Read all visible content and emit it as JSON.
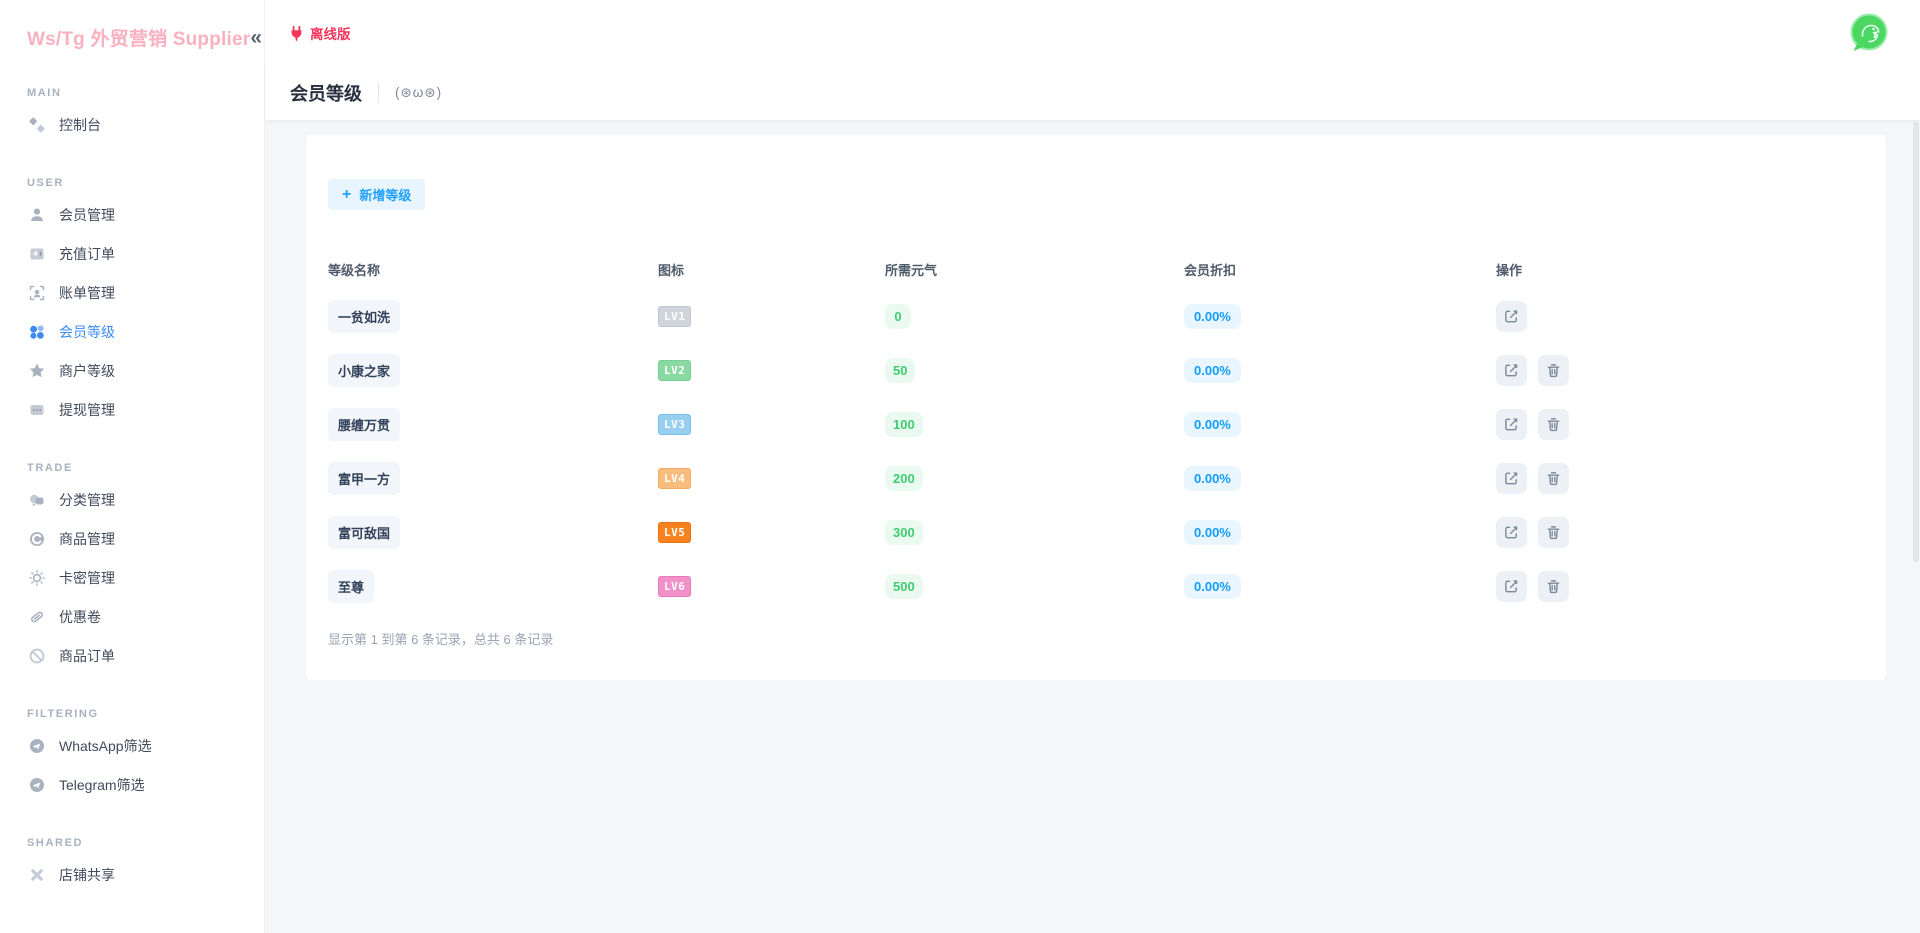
{
  "sidebar": {
    "logo": "Ws/Tg 外贸营销 Supplier",
    "collapse_glyph": "«",
    "sections": [
      {
        "label": "MAIN",
        "items": [
          {
            "label": "控制台",
            "icon": "console-icon",
            "active": false
          }
        ]
      },
      {
        "label": "USER",
        "items": [
          {
            "label": "会员管理",
            "icon": "member-management-icon",
            "active": false
          },
          {
            "label": "充值订单",
            "icon": "recharge-orders-icon",
            "active": false
          },
          {
            "label": "账单管理",
            "icon": "billing-icon",
            "active": false
          },
          {
            "label": "会员等级",
            "icon": "member-level-icon",
            "active": true
          },
          {
            "label": "商户等级",
            "icon": "merchant-level-icon",
            "active": false
          },
          {
            "label": "提现管理",
            "icon": "withdrawal-icon",
            "active": false
          }
        ]
      },
      {
        "label": "TRADE",
        "items": [
          {
            "label": "分类管理",
            "icon": "category-icon",
            "active": false
          },
          {
            "label": "商品管理",
            "icon": "product-icon",
            "active": false
          },
          {
            "label": "卡密管理",
            "icon": "card-key-icon",
            "active": false
          },
          {
            "label": "优惠卷",
            "icon": "coupon-icon",
            "active": false
          },
          {
            "label": "商品订单",
            "icon": "product-orders-icon",
            "active": false
          }
        ]
      },
      {
        "label": "FILTERING",
        "items": [
          {
            "label": "WhatsApp筛选",
            "icon": "whatsapp-filter-icon",
            "active": false
          },
          {
            "label": "Telegram筛选",
            "icon": "telegram-filter-icon",
            "active": false
          }
        ]
      },
      {
        "label": "SHARED",
        "items": [
          {
            "label": "店铺共享",
            "icon": "shop-share-icon",
            "active": false
          }
        ]
      }
    ]
  },
  "topbar": {
    "offline_label": "离线版"
  },
  "page_header": {
    "title": "会员等级",
    "kaomoji": "(⊛ω⊛)"
  },
  "content": {
    "add_button": {
      "plus": "+",
      "label": "新增等级"
    },
    "table": {
      "headers": [
        "等级名称",
        "图标",
        "所需元气",
        "会员折扣",
        "操作"
      ],
      "rows": [
        {
          "name": "一贫如洗",
          "level": "LV1",
          "energy": "0",
          "discount": "0.00%"
        },
        {
          "name": "小康之家",
          "level": "LV2",
          "energy": "50",
          "discount": "0.00%"
        },
        {
          "name": "腰缠万贯",
          "level": "LV3",
          "energy": "100",
          "discount": "0.00%"
        },
        {
          "name": "富甲一方",
          "level": "LV4",
          "energy": "200",
          "discount": "0.00%"
        },
        {
          "name": "富可敌国",
          "level": "LV5",
          "energy": "300",
          "discount": "0.00%"
        },
        {
          "name": "至尊",
          "level": "LV6",
          "energy": "500",
          "discount": "0.00%"
        }
      ]
    },
    "footer_text": "显示第 1 到第 6 条记录，总共 6 条记录"
  },
  "colors": {
    "brand_pink": "#f9b0bf",
    "offline_red": "#f5365c",
    "active_blue": "#3d8bf8",
    "button_blue": "#23a2fe",
    "energy_green": "#3ecd6e",
    "discount_blue": "#129dff",
    "avatar_green": "#4cd763"
  }
}
